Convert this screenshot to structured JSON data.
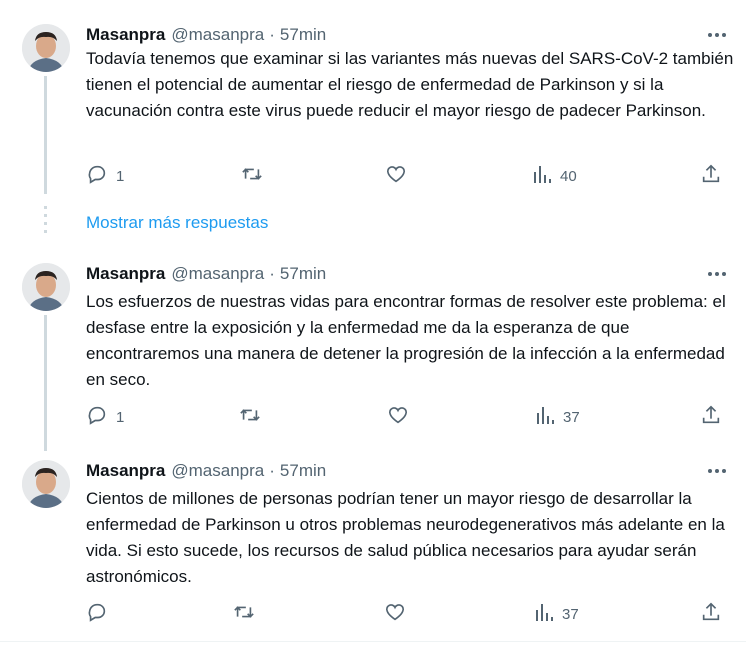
{
  "tweets": [
    {
      "name": "Masanpra",
      "handle": "@masanpra",
      "sep": "·",
      "time": "57min",
      "text": "Todavía tenemos que examinar si las variantes más nuevas del SARS-CoV-2 también tienen el potencial de aumentar el riesgo de enfermedad de Parkinson y si la vacunación contra este virus puede reducir el mayor riesgo de padecer Parkinson.",
      "replies": "1",
      "retweets": "",
      "likes": "",
      "views": "40"
    },
    {
      "name": "Masanpra",
      "handle": "@masanpra",
      "sep": "·",
      "time": "57min",
      "text": "Los esfuerzos de nuestras vidas para encontrar formas de resolver este problema: el desfase entre la exposición y la enfermedad me da la esperanza de que encontraremos una manera de detener la progresión de la infección a la enfermedad en seco.",
      "replies": "1",
      "retweets": "",
      "likes": "",
      "views": "37"
    },
    {
      "name": "Masanpra",
      "handle": "@masanpra",
      "sep": "·",
      "time": "57min",
      "text": "Cientos de millones de personas podrían tener un mayor riesgo de desarrollar la enfermedad de Parkinson u otros problemas neurodegenerativos más adelante en la vida. Si esto sucede, los recursos de salud pública necesarios para ayudar serán astronómicos.",
      "replies": "",
      "retweets": "",
      "likes": "",
      "views": "37"
    }
  ],
  "show_more_label": "Mostrar más respuestas",
  "icons": [
    "reply-icon",
    "retweet-icon",
    "like-icon",
    "views-icon",
    "share-icon",
    "more-icon"
  ],
  "colors": {
    "text": "#0f1419",
    "muted": "#536471",
    "link": "#1d9bf0",
    "line": "#cfd9de"
  }
}
